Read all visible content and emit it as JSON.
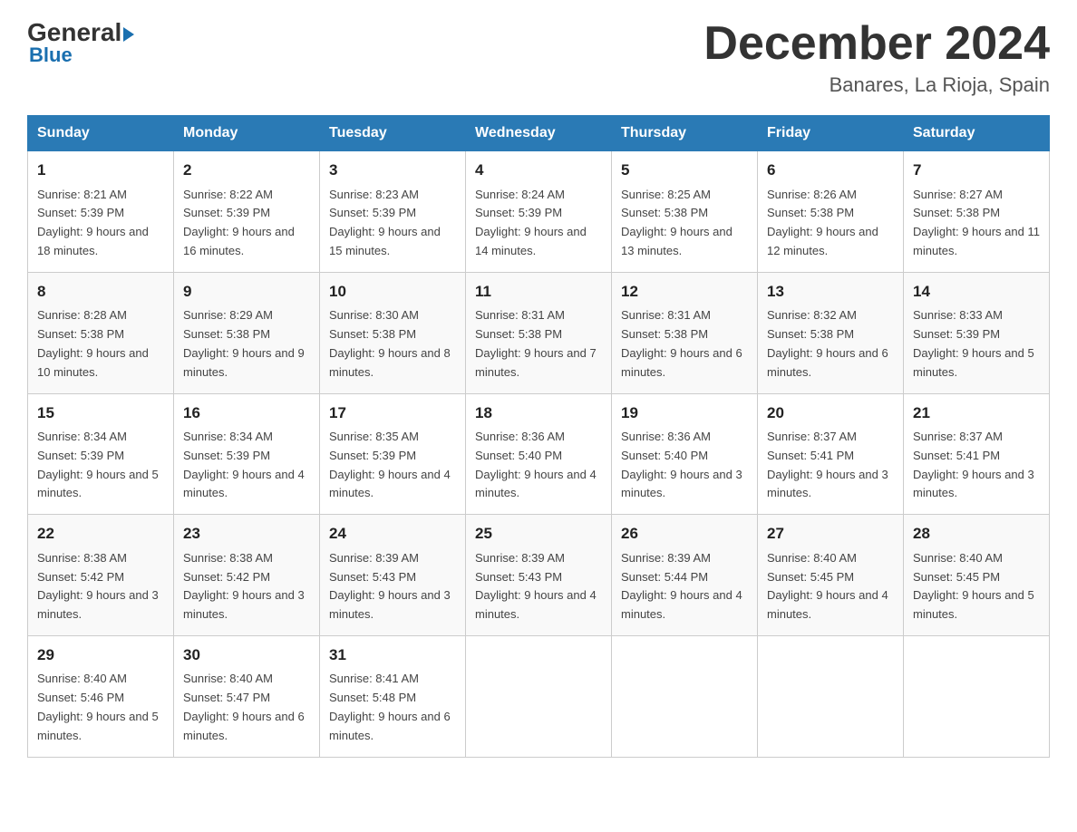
{
  "header": {
    "logo_general": "General",
    "logo_blue": "Blue",
    "month_title": "December 2024",
    "location": "Banares, La Rioja, Spain"
  },
  "weekdays": [
    "Sunday",
    "Monday",
    "Tuesday",
    "Wednesday",
    "Thursday",
    "Friday",
    "Saturday"
  ],
  "weeks": [
    [
      {
        "day": "1",
        "sunrise": "8:21 AM",
        "sunset": "5:39 PM",
        "daylight": "9 hours and 18 minutes."
      },
      {
        "day": "2",
        "sunrise": "8:22 AM",
        "sunset": "5:39 PM",
        "daylight": "9 hours and 16 minutes."
      },
      {
        "day": "3",
        "sunrise": "8:23 AM",
        "sunset": "5:39 PM",
        "daylight": "9 hours and 15 minutes."
      },
      {
        "day": "4",
        "sunrise": "8:24 AM",
        "sunset": "5:39 PM",
        "daylight": "9 hours and 14 minutes."
      },
      {
        "day": "5",
        "sunrise": "8:25 AM",
        "sunset": "5:38 PM",
        "daylight": "9 hours and 13 minutes."
      },
      {
        "day": "6",
        "sunrise": "8:26 AM",
        "sunset": "5:38 PM",
        "daylight": "9 hours and 12 minutes."
      },
      {
        "day": "7",
        "sunrise": "8:27 AM",
        "sunset": "5:38 PM",
        "daylight": "9 hours and 11 minutes."
      }
    ],
    [
      {
        "day": "8",
        "sunrise": "8:28 AM",
        "sunset": "5:38 PM",
        "daylight": "9 hours and 10 minutes."
      },
      {
        "day": "9",
        "sunrise": "8:29 AM",
        "sunset": "5:38 PM",
        "daylight": "9 hours and 9 minutes."
      },
      {
        "day": "10",
        "sunrise": "8:30 AM",
        "sunset": "5:38 PM",
        "daylight": "9 hours and 8 minutes."
      },
      {
        "day": "11",
        "sunrise": "8:31 AM",
        "sunset": "5:38 PM",
        "daylight": "9 hours and 7 minutes."
      },
      {
        "day": "12",
        "sunrise": "8:31 AM",
        "sunset": "5:38 PM",
        "daylight": "9 hours and 6 minutes."
      },
      {
        "day": "13",
        "sunrise": "8:32 AM",
        "sunset": "5:38 PM",
        "daylight": "9 hours and 6 minutes."
      },
      {
        "day": "14",
        "sunrise": "8:33 AM",
        "sunset": "5:39 PM",
        "daylight": "9 hours and 5 minutes."
      }
    ],
    [
      {
        "day": "15",
        "sunrise": "8:34 AM",
        "sunset": "5:39 PM",
        "daylight": "9 hours and 5 minutes."
      },
      {
        "day": "16",
        "sunrise": "8:34 AM",
        "sunset": "5:39 PM",
        "daylight": "9 hours and 4 minutes."
      },
      {
        "day": "17",
        "sunrise": "8:35 AM",
        "sunset": "5:39 PM",
        "daylight": "9 hours and 4 minutes."
      },
      {
        "day": "18",
        "sunrise": "8:36 AM",
        "sunset": "5:40 PM",
        "daylight": "9 hours and 4 minutes."
      },
      {
        "day": "19",
        "sunrise": "8:36 AM",
        "sunset": "5:40 PM",
        "daylight": "9 hours and 3 minutes."
      },
      {
        "day": "20",
        "sunrise": "8:37 AM",
        "sunset": "5:41 PM",
        "daylight": "9 hours and 3 minutes."
      },
      {
        "day": "21",
        "sunrise": "8:37 AM",
        "sunset": "5:41 PM",
        "daylight": "9 hours and 3 minutes."
      }
    ],
    [
      {
        "day": "22",
        "sunrise": "8:38 AM",
        "sunset": "5:42 PM",
        "daylight": "9 hours and 3 minutes."
      },
      {
        "day": "23",
        "sunrise": "8:38 AM",
        "sunset": "5:42 PM",
        "daylight": "9 hours and 3 minutes."
      },
      {
        "day": "24",
        "sunrise": "8:39 AM",
        "sunset": "5:43 PM",
        "daylight": "9 hours and 3 minutes."
      },
      {
        "day": "25",
        "sunrise": "8:39 AM",
        "sunset": "5:43 PM",
        "daylight": "9 hours and 4 minutes."
      },
      {
        "day": "26",
        "sunrise": "8:39 AM",
        "sunset": "5:44 PM",
        "daylight": "9 hours and 4 minutes."
      },
      {
        "day": "27",
        "sunrise": "8:40 AM",
        "sunset": "5:45 PM",
        "daylight": "9 hours and 4 minutes."
      },
      {
        "day": "28",
        "sunrise": "8:40 AM",
        "sunset": "5:45 PM",
        "daylight": "9 hours and 5 minutes."
      }
    ],
    [
      {
        "day": "29",
        "sunrise": "8:40 AM",
        "sunset": "5:46 PM",
        "daylight": "9 hours and 5 minutes."
      },
      {
        "day": "30",
        "sunrise": "8:40 AM",
        "sunset": "5:47 PM",
        "daylight": "9 hours and 6 minutes."
      },
      {
        "day": "31",
        "sunrise": "8:41 AM",
        "sunset": "5:48 PM",
        "daylight": "9 hours and 6 minutes."
      },
      null,
      null,
      null,
      null
    ]
  ]
}
